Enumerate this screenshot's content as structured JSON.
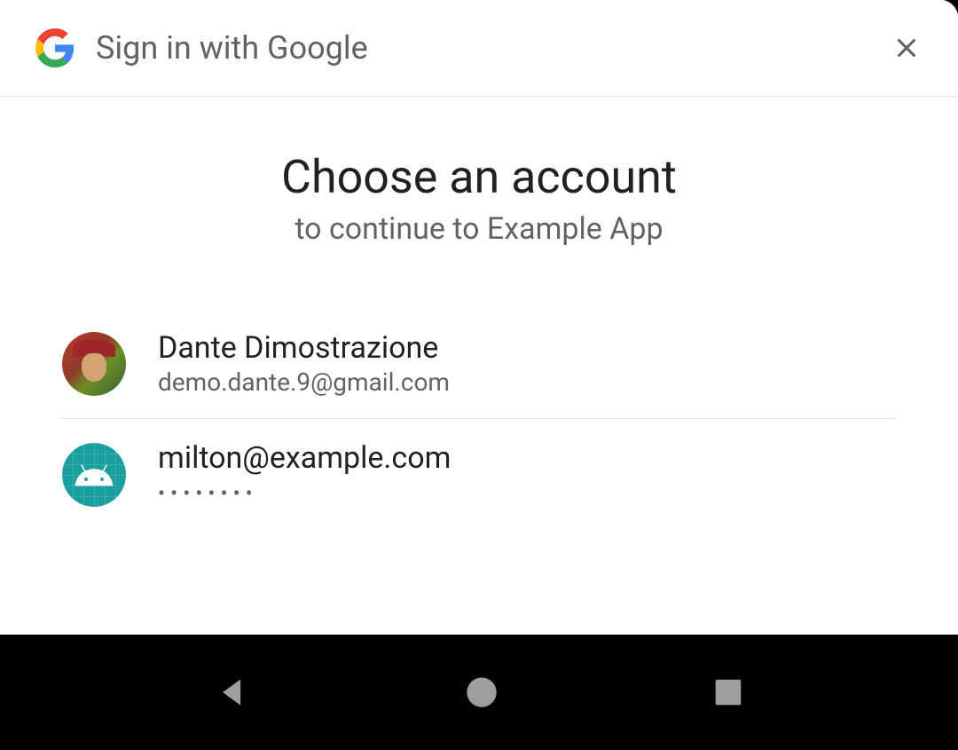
{
  "header": {
    "title": "Sign in with Google"
  },
  "main": {
    "title": "Choose an account",
    "subtitle": "to continue to Example App"
  },
  "accounts": [
    {
      "name": "Dante Dimostrazione",
      "email": "demo.dante.9@gmail.com"
    },
    {
      "name": "milton@example.com",
      "password_dots": "••••••••"
    }
  ]
}
